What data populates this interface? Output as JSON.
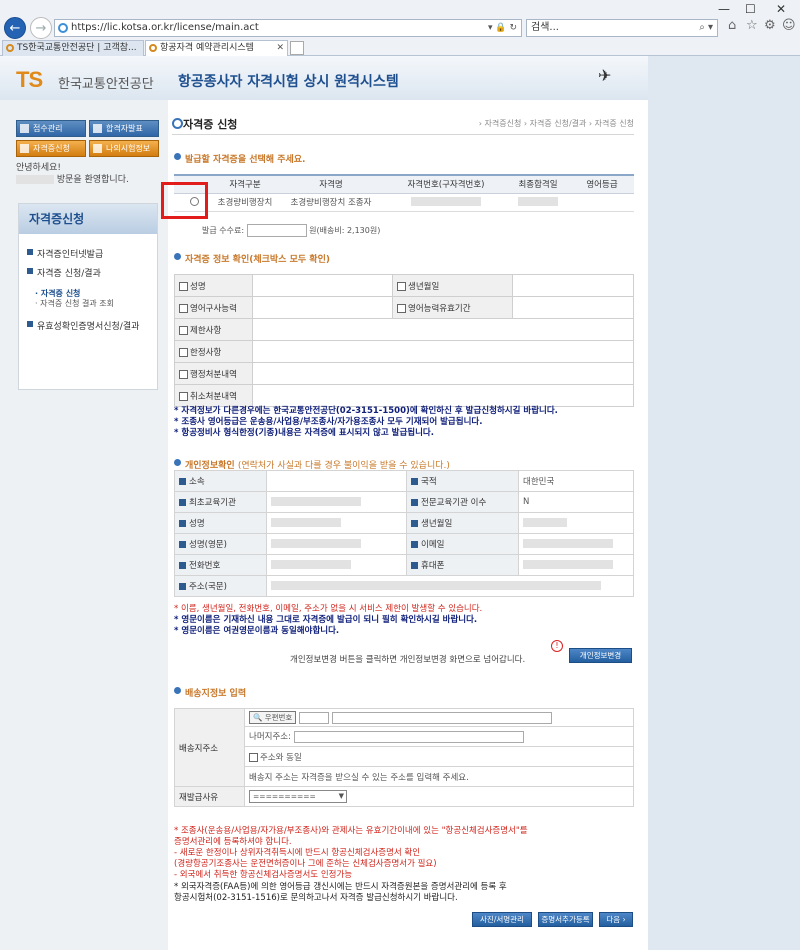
{
  "browser": {
    "url": "https://lic.kotsa.or.kr/license/main.act",
    "url_controls": "▾ 🔒 ↻",
    "search_placeholder": "검색...",
    "tabs": [
      {
        "label": "TS한국교통안전공단 | 고객참..."
      },
      {
        "label": "항공자격 예약관리시스템"
      }
    ]
  },
  "header": {
    "logo_ts": "TS",
    "org": "한국교통안전공단",
    "system": "항공종사자 자격시험 상시 원격시스템"
  },
  "sidebar": {
    "buttons": [
      "접수관리",
      "합격자발표",
      "자격증신청",
      "나의시험정보"
    ],
    "welcome_1": "안녕하세요!",
    "welcome_2": "방문을 환영합니다.",
    "menu_title": "자격증신청",
    "items": [
      "자격증인터넷발급",
      "자격증 신청/결과",
      "유효성확인증명서신청/결과"
    ],
    "subitems": [
      "자격증 신청",
      "자격증 신청 결과 조회"
    ]
  },
  "content": {
    "page_title": "자격증 신청",
    "breadcrumb": "› 자격증신청 › 자격증 신청/결과 › 자격증 신청",
    "sec1": "발급할 자격증을 선택해 주세요.",
    "license_table": {
      "headers": [
        "",
        "자격구분",
        "자격명",
        "자격번호(구자격번호)",
        "최종합격일",
        "영어등급"
      ],
      "row": [
        "",
        "초경량비행장치",
        "초경량비행장치 조종자",
        "",
        "",
        ""
      ]
    },
    "fee_label": "발급 수수료:",
    "fee_suffix": "원(배송비: 2,130원)",
    "sec2": "자격증 정보 확인(체크박스 모두 확인)",
    "check_rows": [
      [
        "성명",
        "생년월일"
      ],
      [
        "영어구사능력",
        "영어능력유효기간"
      ],
      [
        "제한사항"
      ],
      [
        "한정사항"
      ],
      [
        "행정처분내역"
      ],
      [
        "취소처분내역"
      ]
    ],
    "notes1": [
      "* 자격정보가 다른경우에는 한국교통안전공단(02-3151-1500)에 확인하신 후 발급신청하시길 바랍니다.",
      "* 조종사 영어등급은 운송용/사업용/부조종사/자가용조종사 모두 기재되어 발급됩니다.",
      "* 항공정비사 형식한정(기종)내용은 자격증에 표시되지 않고 발급됩니다."
    ],
    "sec3": "개인정보확인",
    "sec3_sub": "(연락처가 사실과 다를 경우 불이익을 받을 수 있습니다.)",
    "personal": [
      [
        "소속",
        "",
        "국적",
        "대한민국"
      ],
      [
        "최초교육기관",
        "",
        "전문교육기관 이수",
        "N"
      ],
      [
        "성명",
        "",
        "생년월일",
        ""
      ],
      [
        "성명(영문)",
        "",
        "이메일",
        ""
      ],
      [
        "전화번호",
        "",
        "휴대폰",
        ""
      ],
      [
        "주소(국문)",
        ""
      ]
    ],
    "notes2_red": "* 이름, 생년월일, 전화번호, 이메일, 주소가 없을 시 서비스 제한이 발생할 수 있습니다.",
    "notes2": [
      "* 영문이름은 기재하신 내용 그대로 자격증에 발급이 되니 필히 확인하시길 바랍니다.",
      "* 영문이름은 여권영문이름과 동일해야합니다."
    ],
    "change_hint": "개인정보변경 버튼을 클릭하면 개인정보변경 화면으로 넘어갑니다.",
    "change_btn": "개인정보변경",
    "alert_icon": "!",
    "sec4": "배송지정보 입력",
    "delivery_label": "배송지주소",
    "zip_btn": "우편번호",
    "rest_addr": "나머지주소:",
    "same_addr": "주소와 동일",
    "addr_hint": "배송지 주소는 자격증을 받으실 수 있는 주소를 입력해 주세요.",
    "reissue_label": "재발급사유",
    "reissue_value": "==========",
    "notes3_red": [
      "* 조종사(운송용/사업용/자가용/부조종사)와 관제사는 유효기간이내에 있는 \"항공신체검사증명서\"를",
      "  증명서관리에 등록하셔야 합니다.",
      "  - 새로운 한정이나 상위자격취득시에 반드시 항공신체검사증명서 확인",
      "    (경량항공기조종사는 운전면허증이나 그에 준하는 신체검사증명서가 필요)",
      "  - 외국에서 취득한 항공신체검사증명서도 인정가능"
    ],
    "notes3": [
      "* 외국자격증(FAA등)에 의한 영어등급 갱신시에는 반드시 자격증원본을 증명서관리에 등록 후",
      "  항공시험처(02-3151-1516)로 문의하고나서 자격증 발급신청하시기 바랍니다."
    ],
    "bottom_buttons": [
      "사진/서명관리",
      "증명서추가등록",
      "다음 ›"
    ]
  }
}
